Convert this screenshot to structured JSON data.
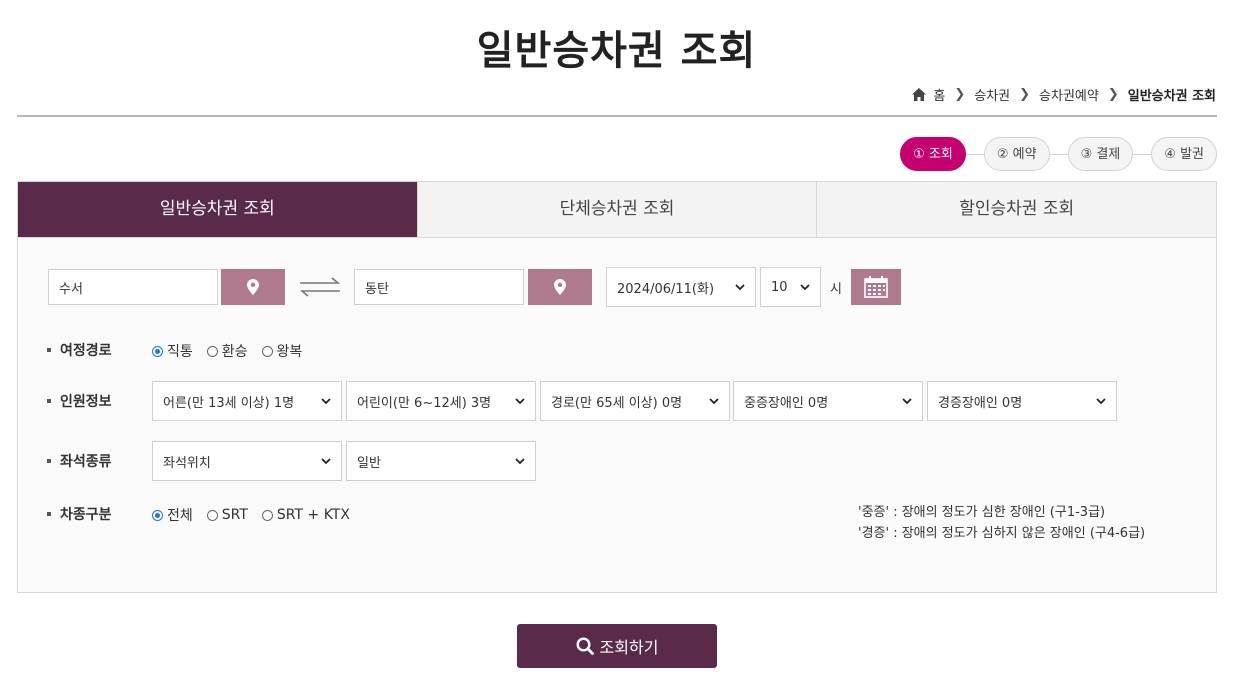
{
  "page": {
    "title": "일반승차권 조회"
  },
  "breadcrumb": {
    "home": "홈",
    "items": [
      "승차권",
      "승차권예약"
    ],
    "current": "일반승차권 조회"
  },
  "steps": [
    {
      "label": "① 조회",
      "active": true
    },
    {
      "label": "② 예약",
      "active": false
    },
    {
      "label": "③ 결제",
      "active": false
    },
    {
      "label": "④ 발권",
      "active": false
    }
  ],
  "tabs": [
    {
      "label": "일반승차권 조회",
      "active": true
    },
    {
      "label": "단체승차권 조회",
      "active": false
    },
    {
      "label": "할인승차권 조회",
      "active": false
    }
  ],
  "route": {
    "departure": "수서",
    "arrival": "동탄",
    "date": "2024/06/11(화)",
    "hour": "10",
    "hour_unit": "시"
  },
  "trip_route": {
    "label": "여정경로",
    "options": [
      "직통",
      "환승",
      "왕복"
    ],
    "selected": "직통"
  },
  "passengers": {
    "label": "인원정보",
    "adult": "어른(만 13세 이상) 1명",
    "child": "어린이(만 6~12세) 3명",
    "senior": "경로(만 65세 이상) 0명",
    "severe_disabled": "중증장애인 0명",
    "mild_disabled": "경증장애인 0명"
  },
  "seat": {
    "label": "좌석종류",
    "position": "좌석위치",
    "class": "일반"
  },
  "train_type": {
    "label": "차종구분",
    "options": [
      "전체",
      "SRT",
      "SRT + KTX"
    ],
    "selected": "전체"
  },
  "notes": [
    "'중증' : 장애의 정도가 심한 장애인 (구1-3급)",
    "'경증' : 장애의 정도가 심하지 않은 장애인 (구4-6급)"
  ],
  "search_button": "조회하기",
  "colors": {
    "primary": "#5a2a4b",
    "step_active": "#c6006f",
    "map_button": "#b07a8e",
    "radio": "#1a73e8"
  }
}
